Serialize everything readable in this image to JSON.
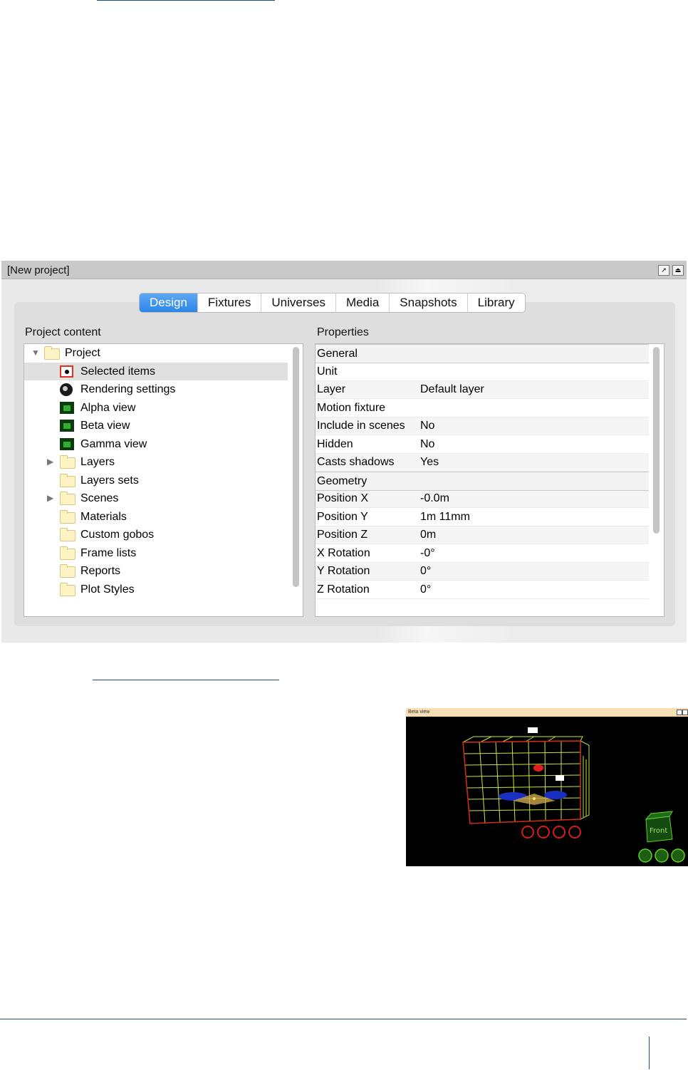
{
  "window": {
    "title": "[New project]",
    "buttons": {
      "float_icon": "undock-icon",
      "eject_icon": "eject-icon"
    }
  },
  "tabs": [
    {
      "label": "Design",
      "active": true
    },
    {
      "label": "Fixtures",
      "active": false
    },
    {
      "label": "Universes",
      "active": false
    },
    {
      "label": "Media",
      "active": false
    },
    {
      "label": "Snapshots",
      "active": false
    },
    {
      "label": "Library",
      "active": false
    }
  ],
  "project_content": {
    "heading": "Project content",
    "items": [
      {
        "label": "Project",
        "icon": "folder-icon",
        "expander": "expanded",
        "selected": false
      },
      {
        "label": "Selected items",
        "icon": "selection-icon",
        "selected": true
      },
      {
        "label": "Rendering settings",
        "icon": "render-icon",
        "selected": false
      },
      {
        "label": "Alpha view",
        "icon": "view-icon",
        "selected": false
      },
      {
        "label": "Beta view",
        "icon": "view-icon",
        "selected": false
      },
      {
        "label": "Gamma view",
        "icon": "view-icon",
        "selected": false
      },
      {
        "label": "Layers",
        "icon": "folder-icon",
        "expander": "collapsed",
        "selected": false
      },
      {
        "label": "Layers sets",
        "icon": "folder-icon",
        "selected": false
      },
      {
        "label": "Scenes",
        "icon": "folder-icon",
        "expander": "collapsed",
        "selected": false
      },
      {
        "label": "Materials",
        "icon": "folder-icon",
        "selected": false
      },
      {
        "label": "Custom gobos",
        "icon": "folder-icon",
        "selected": false
      },
      {
        "label": "Frame lists",
        "icon": "folder-icon",
        "selected": false
      },
      {
        "label": "Reports",
        "icon": "folder-icon",
        "selected": false
      },
      {
        "label": "Plot Styles",
        "icon": "folder-icon",
        "selected": false
      }
    ]
  },
  "properties": {
    "heading": "Properties",
    "rows": [
      {
        "key": "General",
        "value": "",
        "group": true
      },
      {
        "key": "Unit",
        "value": ""
      },
      {
        "key": "Layer",
        "value": "Default layer"
      },
      {
        "key": "Motion fixture",
        "value": ""
      },
      {
        "key": "Include in scenes",
        "value": "No"
      },
      {
        "key": "Hidden",
        "value": "No"
      },
      {
        "key": "Casts shadows",
        "value": "Yes"
      },
      {
        "key": "Geometry",
        "value": "",
        "group": true
      },
      {
        "key": "Position X",
        "value": "-0.0m"
      },
      {
        "key": "Position Y",
        "value": "1m 11mm"
      },
      {
        "key": "Position Z",
        "value": "0m"
      },
      {
        "key": "X Rotation",
        "value": "-0°"
      },
      {
        "key": "Y Rotation",
        "value": "0°"
      },
      {
        "key": "Z Rotation",
        "value": "0°"
      }
    ]
  },
  "beta_view": {
    "title": "Beta view",
    "cube_label": "Front",
    "colors": {
      "grid": "#c8e63a",
      "frame": "#d22a1a",
      "controls": "#d41d1d",
      "nav": "#5fd12a"
    }
  }
}
